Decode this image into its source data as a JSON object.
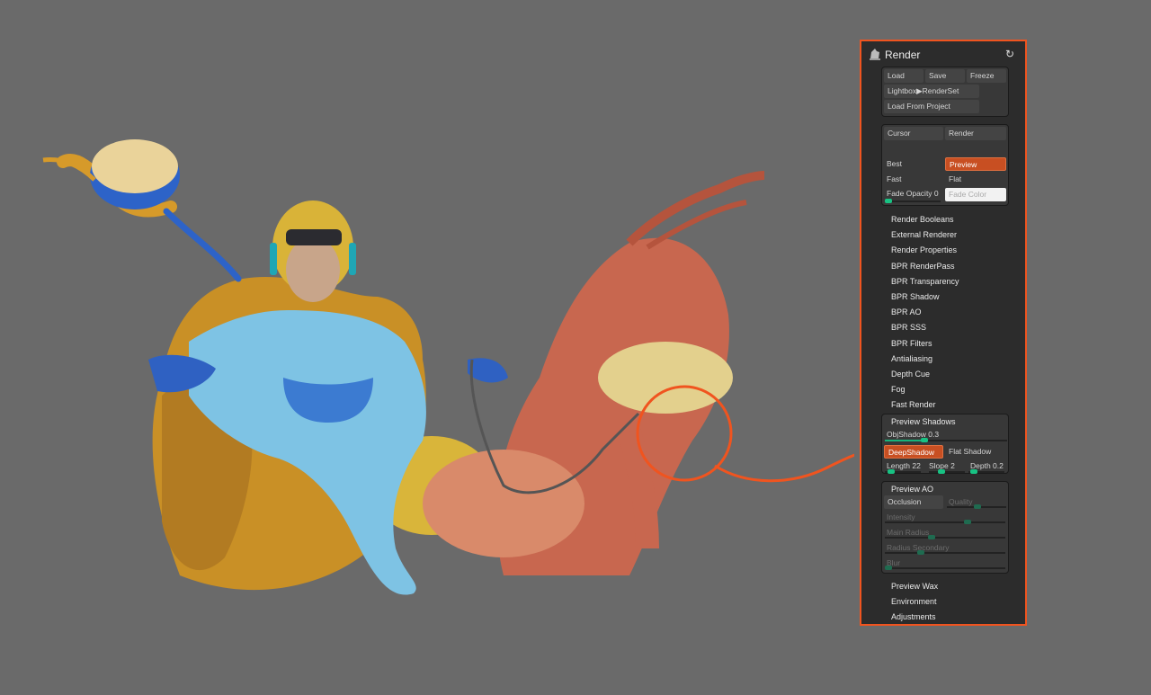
{
  "panel": {
    "title": "Render",
    "icons": {
      "render": "render-teapot-icon",
      "reset": "reset-icon"
    },
    "top_group": {
      "load": "Load",
      "save": "Save",
      "freeze": "Freeze",
      "lightbox": "Lightbox▶RenderSet",
      "load_project": "Load From Project"
    },
    "mode_group": {
      "cursor": "Cursor",
      "render": "Render",
      "best": "Best",
      "preview": "Preview",
      "fast": "Fast",
      "flat": "Flat",
      "fade_opacity": "Fade Opacity 0",
      "fade_color": "Fade Color"
    },
    "menu_items": [
      "Render Booleans",
      "External Renderer",
      "Render Properties",
      "BPR RenderPass",
      "BPR Transparency",
      "BPR Shadow",
      "BPR AO",
      "BPR SSS",
      "BPR Filters",
      "Antialiasing",
      "Depth Cue",
      "Fog",
      "Fast Render"
    ],
    "preview_shadows": {
      "title": "Preview Shadows",
      "objshadow": "ObjShadow 0.3",
      "deepshadow": "DeepShadow",
      "flatshadow": "Flat Shadow",
      "length": "Length 22",
      "slope": "Slope 2",
      "depth": "Depth 0.2"
    },
    "preview_ao": {
      "title": "Preview AO",
      "occlusion": "Occlusion",
      "quality": "Quality",
      "intensity": "Intensity",
      "main_radius": "Main Radius",
      "radius_secondary": "Radius Secondary",
      "blur": "Blur"
    },
    "bottom_items": [
      "Preview Wax",
      "Environment",
      "Adjustments"
    ]
  },
  "colors": {
    "highlight": "#f0541f",
    "active_button": "#c84f22",
    "slider": "#17b37a",
    "background": "#6a6a6a"
  }
}
